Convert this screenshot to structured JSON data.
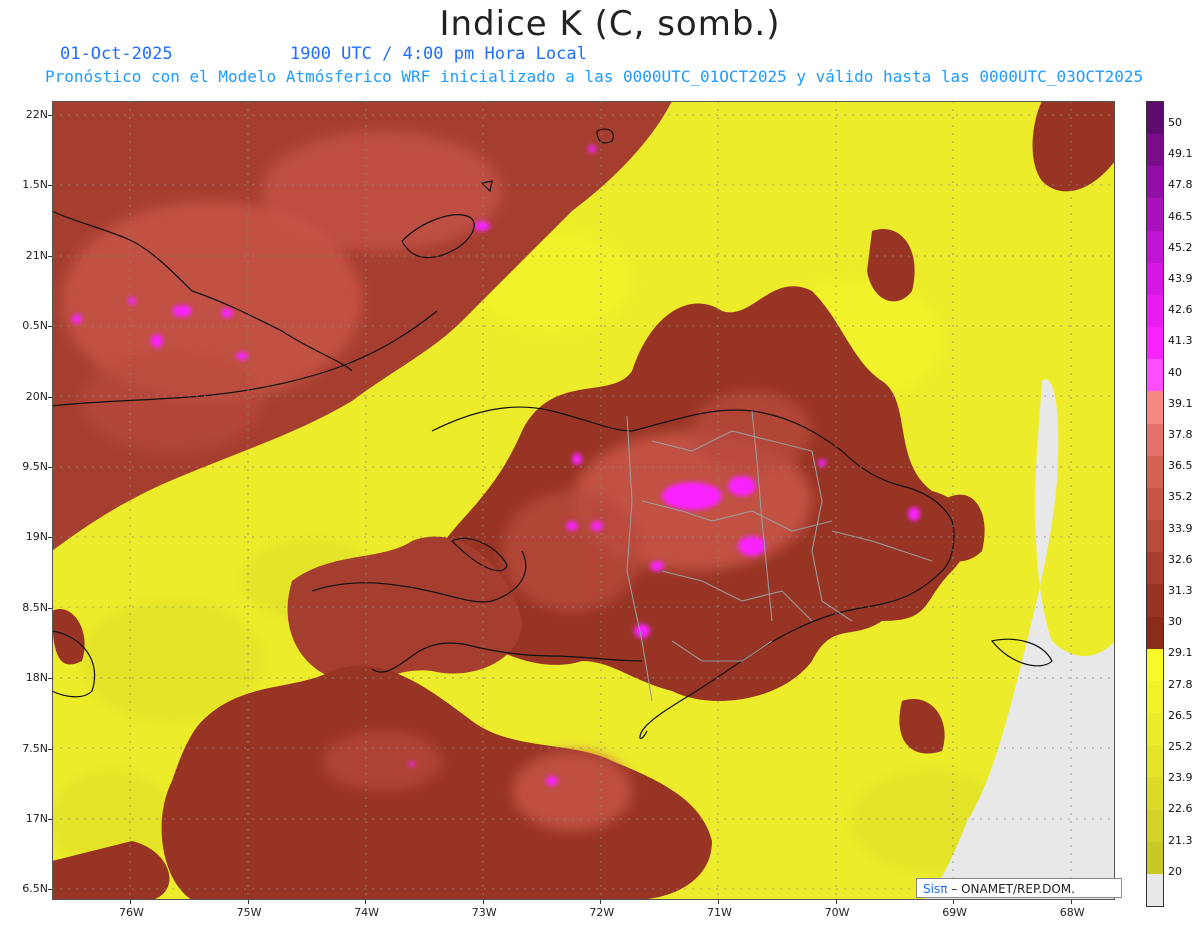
{
  "header": {
    "title": "Indice K (C, somb.)",
    "date": "01-Oct-2025",
    "time": "1900 UTC / 4:00 pm Hora Local",
    "description": "Pronóstico con el Modelo Atmósferico WRF inicializado a las 0000UTC_01OCT2025 y válido hasta las  0000UTC_03OCT2025"
  },
  "axes": {
    "lat_labels": [
      "22N",
      "1.5N",
      "21N",
      "0.5N",
      "20N",
      "9.5N",
      "19N",
      "8.5N",
      "18N",
      "7.5N",
      "17N",
      "6.5N"
    ],
    "lon_labels": [
      "76W",
      "75W",
      "74W",
      "73W",
      "72W",
      "71W",
      "70W",
      "69W",
      "68W"
    ]
  },
  "colorbar": {
    "labels": [
      "50",
      "49.1",
      "47.8",
      "46.5",
      "45.2",
      "43.9",
      "42.6",
      "41.3",
      "40",
      "39.1",
      "37.8",
      "36.5",
      "35.2",
      "33.9",
      "32.6",
      "31.3",
      "30",
      "29.1",
      "27.8",
      "26.5",
      "25.2",
      "23.9",
      "22.6",
      "21.3",
      "20"
    ],
    "colors": [
      "#5e0a6e",
      "#7a0c8a",
      "#920fa6",
      "#a812bc",
      "#c015d2",
      "#d418e2",
      "#e61cf0",
      "#f822ff",
      "#ff4dff",
      "#f48a80",
      "#e47268",
      "#d66256",
      "#c85648",
      "#b84a3c",
      "#a63e30",
      "#983424",
      "#8a2a18",
      "#f8f82a",
      "#f2f22a",
      "#ecec2a",
      "#e4e42a",
      "#dcdc28",
      "#d2d228",
      "#c8c826",
      "#e8e8e8"
    ]
  },
  "credit": {
    "brand": "Sisπ",
    "org": "– ONAMET/REP.DOM."
  }
}
